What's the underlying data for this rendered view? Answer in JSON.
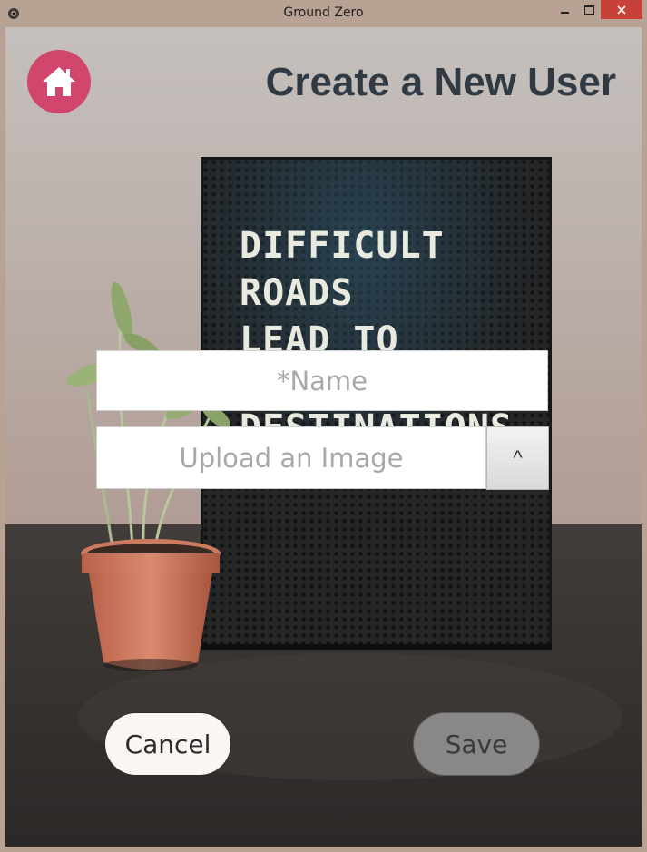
{
  "window": {
    "title": "Ground Zero",
    "icon": "app-eye-icon",
    "controls": [
      "minimize-icon",
      "maximize-icon",
      "close-icon"
    ],
    "close_color": "#c7413a"
  },
  "header": {
    "home_icon": "home-icon",
    "home_color": "#d0466c",
    "title": "Create a New User",
    "title_color": "#2f3a44"
  },
  "background": {
    "letterboard_lines": [
      "DIFFICULT",
      "ROADS",
      "LEAD TO",
      "DESTINATIONS"
    ]
  },
  "form": {
    "name_placeholder": "*Name",
    "name_value": "",
    "upload_placeholder": "Upload an Image",
    "upload_button_label": "^"
  },
  "actions": {
    "cancel_label": "Cancel",
    "save_label": "Save"
  }
}
